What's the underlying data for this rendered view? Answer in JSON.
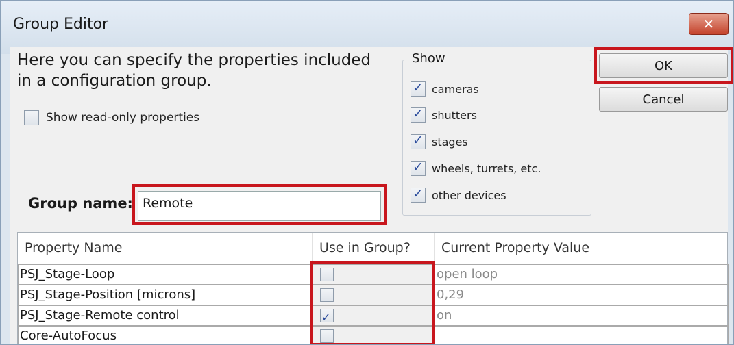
{
  "window": {
    "title": "Group Editor",
    "close_symbol": "✕"
  },
  "description": "Here you can specify the properties included in a configuration group.",
  "show_read_only": {
    "label": "Show read-only properties",
    "checked": false
  },
  "show": {
    "legend": "Show",
    "items": [
      {
        "label": "cameras",
        "checked": true
      },
      {
        "label": "shutters",
        "checked": true
      },
      {
        "label": "stages",
        "checked": true
      },
      {
        "label": "wheels, turrets, etc.",
        "checked": true
      },
      {
        "label": "other devices",
        "checked": true
      }
    ]
  },
  "buttons": {
    "ok": "OK",
    "cancel": "Cancel"
  },
  "group_name": {
    "label": "Group name:",
    "value": "Remote"
  },
  "table": {
    "headers": [
      "Property Name",
      "Use in Group?",
      "Current Property Value"
    ],
    "rows": [
      {
        "name": "PSJ_Stage-Loop",
        "use": false,
        "value": "open loop"
      },
      {
        "name": "PSJ_Stage-Position [microns]",
        "use": false,
        "value": "0,29"
      },
      {
        "name": "PSJ_Stage-Remote control",
        "use": true,
        "value": "on"
      },
      {
        "name": "Core-AutoFocus",
        "use": false,
        "value": ""
      }
    ]
  },
  "colors": {
    "highlight": "#c8161d",
    "titlebar": "#dde6ef",
    "close": "#c4432c"
  }
}
